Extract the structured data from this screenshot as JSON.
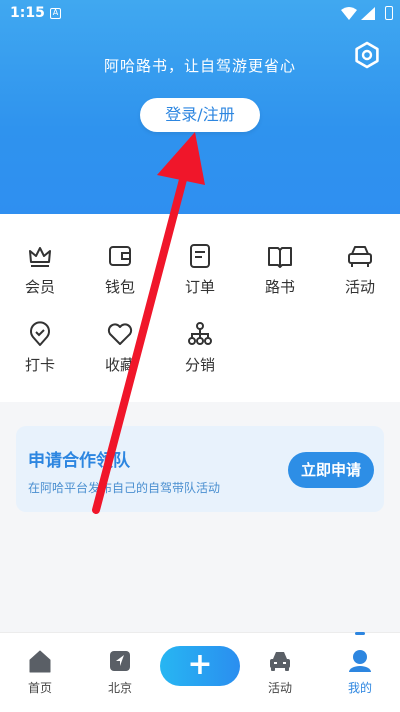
{
  "status_bar": {
    "time": "1:15",
    "notif_glyph": "A"
  },
  "header": {
    "slogan": "阿哈路书，让自驾游更省心",
    "login_label": "登录/注册",
    "settings_icon": "hexagon-gear-icon"
  },
  "menu": {
    "items": [
      {
        "label": "会员",
        "icon": "crown-icon"
      },
      {
        "label": "钱包",
        "icon": "wallet-icon"
      },
      {
        "label": "订单",
        "icon": "order-icon"
      },
      {
        "label": "路书",
        "icon": "book-icon"
      },
      {
        "label": "活动",
        "icon": "car-icon"
      },
      {
        "label": "打卡",
        "icon": "location-check-icon"
      },
      {
        "label": "收藏",
        "icon": "heart-icon"
      },
      {
        "label": "分销",
        "icon": "share-tree-icon"
      }
    ]
  },
  "promo": {
    "title": "申请合作领队",
    "subtitle": "在阿哈平台发布自己的自驾带队活动",
    "button_label": "立即申请"
  },
  "tabbar": {
    "tabs": [
      {
        "label": "首页",
        "icon": "home-icon"
      },
      {
        "label": "北京",
        "icon": "map-pin-icon"
      },
      {
        "label": "",
        "icon": "plus-icon"
      },
      {
        "label": "活动",
        "icon": "car-icon"
      },
      {
        "label": "我的",
        "icon": "user-icon"
      }
    ],
    "plus_glyph": "+",
    "active_tab": "我的"
  },
  "colors": {
    "header_blue": "#2f93ee",
    "accent": "#2d86e0",
    "annotation_arrow": "#f0162a"
  }
}
